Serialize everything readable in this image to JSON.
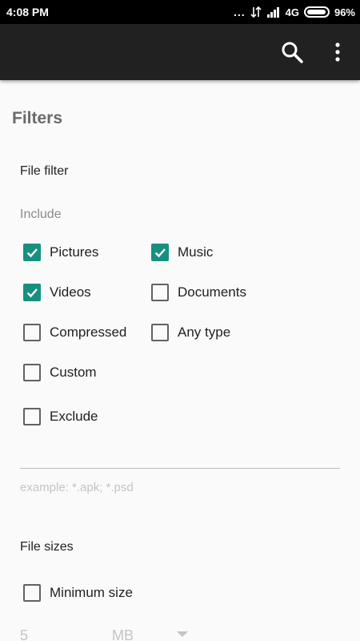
{
  "status_bar": {
    "time": "4:08 PM",
    "dots": "...",
    "network": "4G",
    "battery": "96%",
    "battery_level": 0.96
  },
  "app_bar": {
    "search_icon": "search-icon",
    "more_icon": "more-vert-icon"
  },
  "filters": {
    "title": "Filters",
    "file_filter_label": "File filter",
    "include_label": "Include",
    "checkboxes": {
      "pictures": {
        "label": "Pictures",
        "checked": true
      },
      "music": {
        "label": "Music",
        "checked": true
      },
      "videos": {
        "label": "Videos",
        "checked": true
      },
      "documents": {
        "label": "Documents",
        "checked": false
      },
      "compressed": {
        "label": "Compressed",
        "checked": false
      },
      "any_type": {
        "label": "Any type",
        "checked": false
      },
      "custom": {
        "label": "Custom",
        "checked": false
      },
      "exclude": {
        "label": "Exclude",
        "checked": false
      }
    },
    "custom_input_placeholder": "example: *.apk; *.psd"
  },
  "file_sizes": {
    "label": "File sizes",
    "minimum_size": {
      "label": "Minimum size",
      "checked": false
    },
    "min_value": "5",
    "unit": "MB"
  },
  "colors": {
    "accent": "#179080",
    "app_bar": "#212121",
    "background": "#fafafa"
  }
}
